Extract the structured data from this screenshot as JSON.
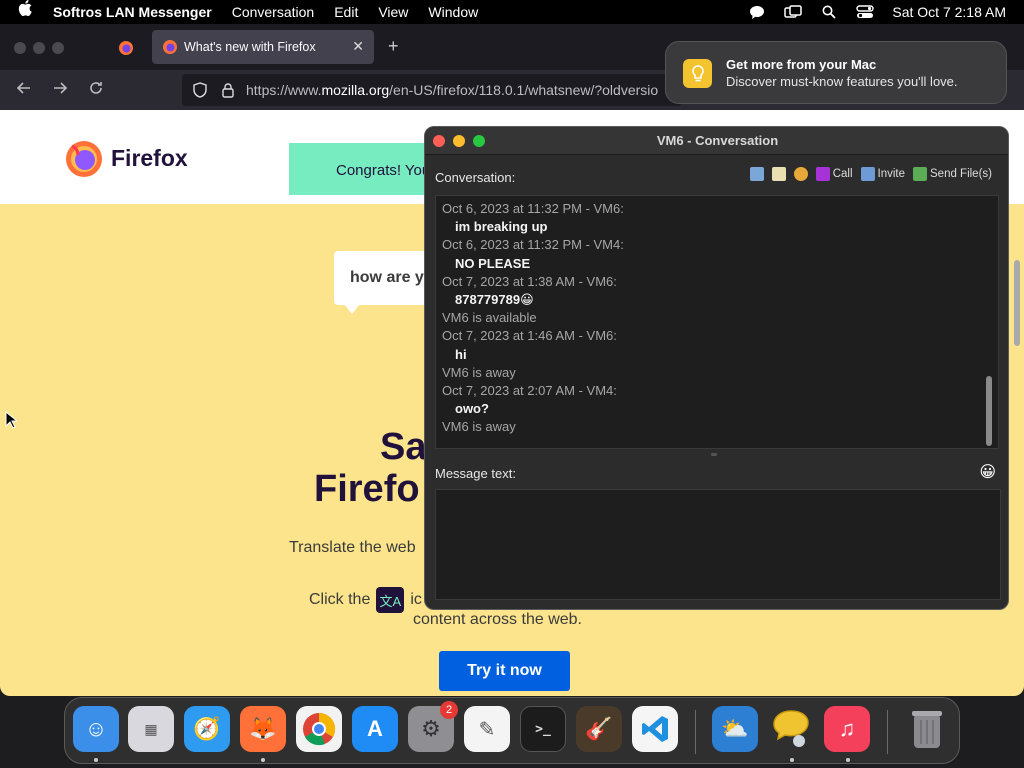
{
  "menubar": {
    "app_name": "Softros LAN Messenger",
    "items": [
      "Conversation",
      "Edit",
      "View",
      "Window"
    ],
    "clock": "Sat Oct 7  2:18 AM"
  },
  "browser": {
    "active_tab_title": "What's new with Firefox",
    "url_prefix": "https://www.",
    "url_domain": "mozilla.org",
    "url_rest": "/en-US/firefox/118.0.1/whatsnew/?oldversio"
  },
  "page": {
    "brand": "Firefox",
    "congrats_text": "Congrats! You",
    "bubble_text": "how are y",
    "hero_line1": "Sa",
    "hero_line2": "Firefo",
    "translate_text": "Translate the web",
    "click_text": "Click the",
    "click_text_after": "ic",
    "content_text": "content across the web.",
    "cta_label": "Try it now"
  },
  "notification": {
    "title": "Get more from your Mac",
    "body": "Discover must-know features you'll love."
  },
  "conversation": {
    "window_title": "VM6 - Conversation",
    "label": "Conversation:",
    "toolbar": {
      "call": "Call",
      "invite": "Invite",
      "send_files": "Send File(s)"
    },
    "history": [
      {
        "type": "meta",
        "text": "Oct 6, 2023 at 11:32 PM - VM6:"
      },
      {
        "type": "msg",
        "text": "im breaking up"
      },
      {
        "type": "meta",
        "text": "Oct 6, 2023 at 11:32 PM - VM4:"
      },
      {
        "type": "msg",
        "text": "NO PLEASE"
      },
      {
        "type": "meta",
        "text": "Oct 7, 2023 at 1:38 AM - VM6:"
      },
      {
        "type": "msg",
        "text": "878779789😀"
      },
      {
        "type": "status",
        "text": "VM6 is available"
      },
      {
        "type": "meta",
        "text": "Oct 7, 2023 at 1:46 AM - VM6:"
      },
      {
        "type": "msg",
        "text": "hi"
      },
      {
        "type": "status",
        "text": "VM6 is away"
      },
      {
        "type": "meta",
        "text": "Oct 7, 2023 at 2:07 AM - VM4:"
      },
      {
        "type": "msg",
        "text": "owo?"
      },
      {
        "type": "status",
        "text": "VM6 is away"
      }
    ],
    "message_label": "Message text:",
    "message_value": ""
  },
  "dock": {
    "apps": [
      {
        "name": "Finder",
        "color": "#3b8fe8"
      },
      {
        "name": "Launchpad",
        "color": "#d8d8de"
      },
      {
        "name": "Safari",
        "color": "#2f9bf0"
      },
      {
        "name": "Firefox",
        "color": "#ff7139"
      },
      {
        "name": "Chrome",
        "color": "#f2f2f2"
      },
      {
        "name": "App Store",
        "color": "#1f8bf5"
      },
      {
        "name": "System Settings",
        "color": "#8e8e93"
      },
      {
        "name": "TextEdit",
        "color": "#f4f4f4"
      },
      {
        "name": "Terminal",
        "color": "#1c1c1c"
      },
      {
        "name": "GarageBand",
        "color": "#4a3a2a"
      },
      {
        "name": "Visual Studio Code",
        "color": "#f5f5f5"
      },
      {
        "name": "Weather",
        "color": "#2d7fd4"
      },
      {
        "name": "Softros LAN Messenger",
        "color": "#f0c330"
      },
      {
        "name": "Music",
        "color": "#f5405c"
      },
      {
        "name": "Trash",
        "color": "#7c7c80"
      }
    ],
    "settings_badge": "2"
  },
  "colors": {
    "page_bg": "#fbe48b",
    "cta": "#0060df",
    "congrats": "#77ecc1"
  }
}
